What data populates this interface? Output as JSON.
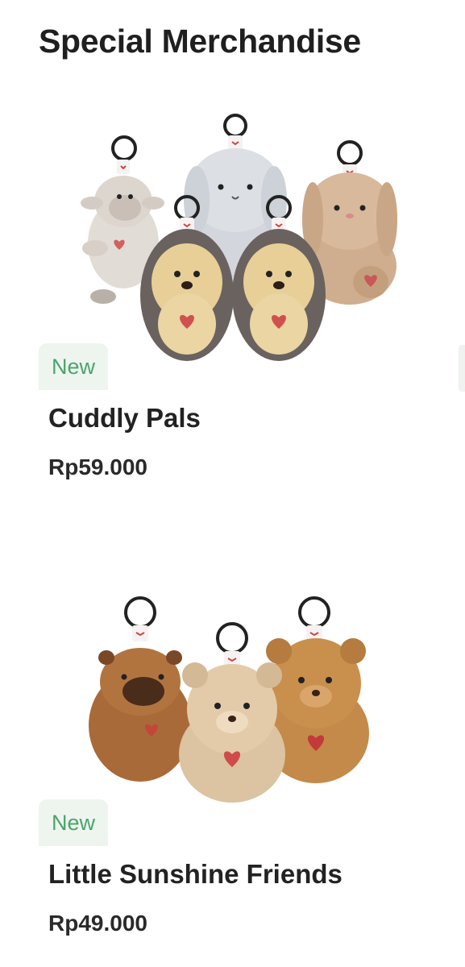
{
  "page": {
    "title": "Special Merchandise"
  },
  "products": [
    {
      "badge": "New",
      "name": "Cuddly Pals",
      "price": "Rp59.000",
      "image_icon": "plush-keychain-group-image"
    },
    {
      "badge": "New",
      "name": "Little Sunshine Friends",
      "price": "Rp49.000",
      "image_icon": "plush-keychain-trio-image"
    }
  ],
  "colors": {
    "badge_bg": "#eef5ef",
    "badge_text": "#4aa56b",
    "text": "#1f1f1f"
  }
}
